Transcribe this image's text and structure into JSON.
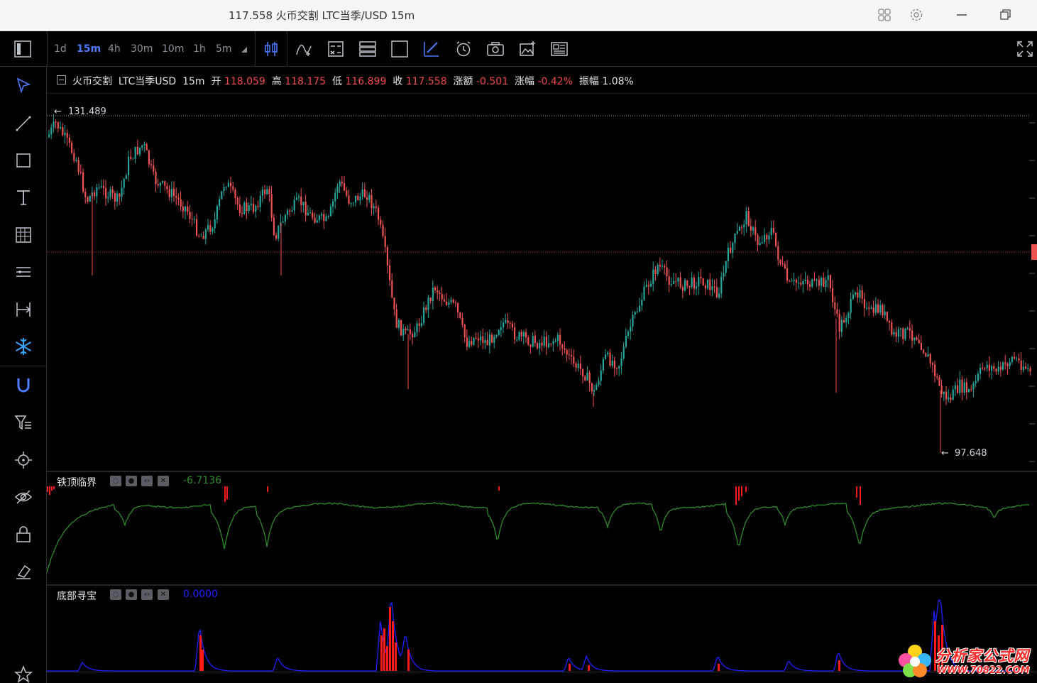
{
  "window": {
    "title": "117.558 火币交割 LTC当季/USD 15m"
  },
  "toolbar": {
    "timeframes": [
      "1d",
      "15m",
      "4h",
      "30m",
      "10m",
      "1h",
      "5m"
    ],
    "active_timeframe": "15m"
  },
  "legend": {
    "exchange": "火币交割",
    "symbol": "LTC当季USD",
    "interval": "15m",
    "open_label": "开",
    "open": "118.059",
    "high_label": "高",
    "high": "118.175",
    "low_label": "低",
    "low": "116.899",
    "close_label": "收",
    "close": "117.558",
    "change_label": "涨额",
    "change": "-0.501",
    "pct_label": "涨幅",
    "pct": "-0.42%",
    "amp_label": "振幅",
    "amp": "1.08%"
  },
  "chart_data": [
    {
      "type": "candlestick",
      "high_marker": "131.489",
      "low_marker": "97.648",
      "current_price_line": "117.558",
      "colors": {
        "up": "#26a69a",
        "down": "#ef5350"
      }
    },
    {
      "type": "line",
      "title": "铁顶临界",
      "value": "-6.7136",
      "colors": {
        "line": "#2f8a2a",
        "bars": "#ff1a1a"
      }
    },
    {
      "type": "area",
      "title": "底部寻宝",
      "value": "0.0000",
      "colors": {
        "line": "#2020ff",
        "bars": "#ff1a1a"
      }
    }
  ],
  "watermark": {
    "name": "分析家公式网",
    "url": "WWW.70822.COM"
  }
}
